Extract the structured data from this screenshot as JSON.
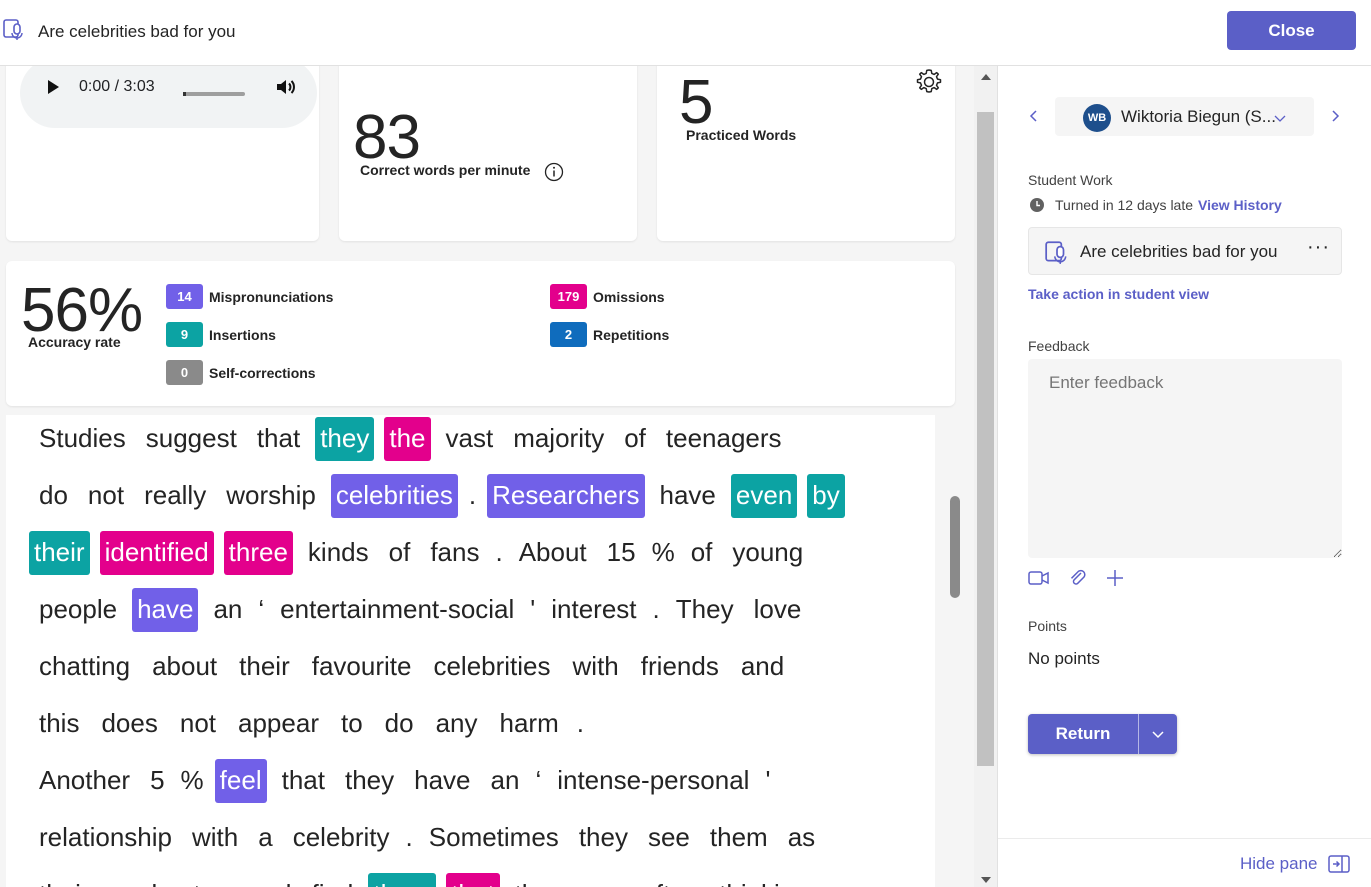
{
  "header": {
    "title": "Are celebrities bad for you",
    "close_label": "Close"
  },
  "audio": {
    "time": "0:00 / 3:03",
    "progress": 0.0
  },
  "stats": {
    "cwpm_value": "83",
    "cwpm_label": "Correct words per minute",
    "practiced_value": "5",
    "practiced_label": "Practiced Words",
    "accuracy_value": "56%",
    "accuracy_label": "Accuracy rate"
  },
  "errors": {
    "mispronunciations": {
      "count": "14",
      "label": "Mispronunciations",
      "color": "#7160e8"
    },
    "insertions": {
      "count": "9",
      "label": "Insertions",
      "color": "#0ca3a3"
    },
    "self_corrections": {
      "count": "0",
      "label": "Self-corrections",
      "color": "#8a8a8a"
    },
    "omissions": {
      "count": "179",
      "label": "Omissions",
      "color": "#e3008c"
    },
    "repetitions": {
      "count": "2",
      "label": "Repetitions",
      "color": "#0f6cbd"
    }
  },
  "passage": {
    "lines": [
      [
        {
          "t": "Studies"
        },
        {
          "t": "suggest"
        },
        {
          "t": "that"
        },
        {
          "t": "they",
          "k": "ins"
        },
        {
          "t": "the",
          "k": "omi"
        },
        {
          "t": "vast"
        },
        {
          "t": "majority"
        },
        {
          "t": "of"
        },
        {
          "t": "teenagers"
        }
      ],
      [
        {
          "t": "do"
        },
        {
          "t": "not"
        },
        {
          "t": "really"
        },
        {
          "t": "worship"
        },
        {
          "t": "celebrities",
          "k": "mis"
        },
        {
          "t": "."
        },
        {
          "t": "Researchers",
          "k": "mis"
        },
        {
          "t": "have"
        },
        {
          "t": "even",
          "k": "ins"
        },
        {
          "t": "by",
          "k": "ins"
        }
      ],
      [
        {
          "t": "their",
          "k": "ins"
        },
        {
          "t": "identified",
          "k": "omi"
        },
        {
          "t": "three",
          "k": "omi"
        },
        {
          "t": "kinds"
        },
        {
          "t": "of"
        },
        {
          "t": "fans"
        },
        {
          "t": "."
        },
        {
          "t": "About"
        },
        {
          "t": "15"
        },
        {
          "t": "%"
        },
        {
          "t": "of"
        },
        {
          "t": "young"
        }
      ],
      [
        {
          "t": "people"
        },
        {
          "t": "have",
          "k": "mis"
        },
        {
          "t": "an"
        },
        {
          "t": "‘"
        },
        {
          "t": "entertainment-social"
        },
        {
          "t": "'"
        },
        {
          "t": "interest"
        },
        {
          "t": "."
        },
        {
          "t": "They"
        },
        {
          "t": "love"
        }
      ],
      [
        {
          "t": "chatting"
        },
        {
          "t": "about"
        },
        {
          "t": "their"
        },
        {
          "t": "favourite"
        },
        {
          "t": "celebrities"
        },
        {
          "t": "with"
        },
        {
          "t": "friends"
        },
        {
          "t": "and"
        }
      ],
      [
        {
          "t": "this"
        },
        {
          "t": "does"
        },
        {
          "t": "not"
        },
        {
          "t": "appear"
        },
        {
          "t": "to"
        },
        {
          "t": "do"
        },
        {
          "t": "any"
        },
        {
          "t": "harm"
        },
        {
          "t": "."
        }
      ],
      [
        {
          "t": "Another"
        },
        {
          "t": "5"
        },
        {
          "t": "%"
        },
        {
          "t": "feel",
          "k": "mis"
        },
        {
          "t": "that"
        },
        {
          "t": "they"
        },
        {
          "t": "have"
        },
        {
          "t": "an"
        },
        {
          "t": "‘"
        },
        {
          "t": "intense-personal"
        },
        {
          "t": "'"
        }
      ],
      [
        {
          "t": "relationship"
        },
        {
          "t": "with"
        },
        {
          "t": "a"
        },
        {
          "t": "celebrity"
        },
        {
          "t": "."
        },
        {
          "t": "Sometimes"
        },
        {
          "t": "they"
        },
        {
          "t": "see"
        },
        {
          "t": "them"
        },
        {
          "t": "as"
        }
      ],
      [
        {
          "t": "their"
        },
        {
          "t": "soulmates"
        },
        {
          "t": "and"
        },
        {
          "t": "find"
        },
        {
          "t": "them",
          "k": "ins"
        },
        {
          "t": "that",
          "k": "omi"
        },
        {
          "t": "they"
        },
        {
          "t": "are"
        },
        {
          "t": "often"
        },
        {
          "t": "thinking"
        }
      ]
    ]
  },
  "sidebar": {
    "student_initials": "WB",
    "student_name": "Wiktoria Biegun (S...",
    "student_work_label": "Student Work",
    "turned_in_text": "Turned in 12 days late",
    "view_history_label": "View History",
    "work_item_name": "Are celebrities bad for you",
    "work_item_more": "···",
    "take_action_label": "Take action in student view",
    "feedback_label": "Feedback",
    "feedback_placeholder": "Enter feedback",
    "points_label": "Points",
    "points_value": "No points",
    "return_label": "Return",
    "hide_pane_label": "Hide pane"
  },
  "colors": {
    "accent": "#5b5fc7",
    "mispronunciation": "#7160e8",
    "insertion": "#0ca3a3",
    "omission": "#e3008c"
  }
}
